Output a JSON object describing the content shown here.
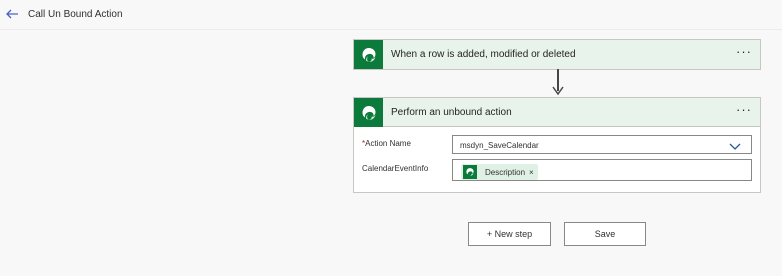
{
  "header": {
    "title": "Call Un Bound Action",
    "back_icon": "arrow-left-icon"
  },
  "trigger_card": {
    "icon": "dataverse-icon",
    "title": "When a row is added, modified or deleted",
    "menu": "···",
    "color": "#0b7a3a"
  },
  "action_card": {
    "icon": "dataverse-icon",
    "title": "Perform an unbound action",
    "menu": "···",
    "fields": {
      "action_name": {
        "required_mark": "*",
        "label": "Action Name",
        "value": "msdyn_SaveCalendar"
      },
      "calendar_event_info": {
        "label": "CalendarEventInfo",
        "token": {
          "label": "Description",
          "remove": "×"
        }
      }
    }
  },
  "buttons": {
    "new_step": "+ New step",
    "save": "Save"
  },
  "colors": {
    "header_bg": "#e8f3ec",
    "accent": "#0b7a3a",
    "chevron": "#2b5797"
  }
}
